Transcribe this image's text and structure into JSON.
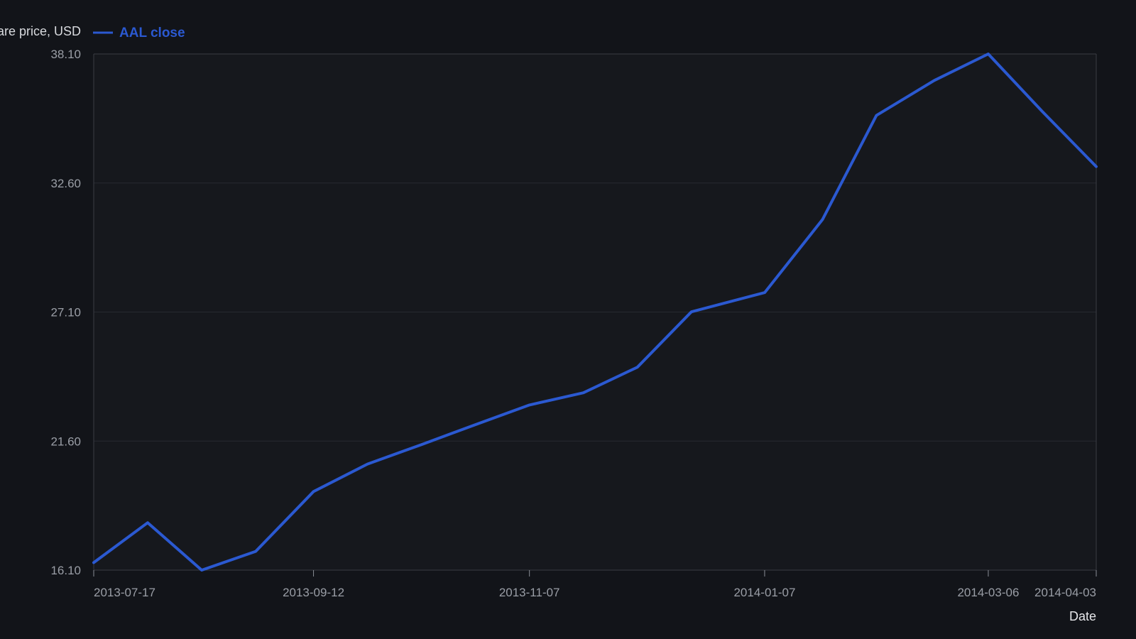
{
  "colors": {
    "background": "#121419",
    "plot_background": "#16181d",
    "grid": "#262930",
    "axis": "#3a3d44",
    "series": "#2b59d1"
  },
  "chart_data": {
    "type": "line",
    "xlabel": "Date",
    "ylabel": "Share price, USD",
    "ylim": [
      16.1,
      38.1
    ],
    "yticks": [
      "16.10",
      "21.60",
      "27.10",
      "32.60",
      "38.10"
    ],
    "xticks": [
      "2013-07-17",
      "2013-09-12",
      "2013-11-07",
      "2014-01-07",
      "2014-03-06",
      "2014-04-03"
    ],
    "grid": true,
    "legend_position": "top-left",
    "series": [
      {
        "name": "AAL close",
        "x": [
          "2013-07-17",
          "2013-07-31",
          "2013-08-14",
          "2013-08-28",
          "2013-09-12",
          "2013-09-26",
          "2013-10-10",
          "2013-10-24",
          "2013-11-07",
          "2013-11-21",
          "2013-12-05",
          "2013-12-19",
          "2014-01-07",
          "2014-01-22",
          "2014-02-05",
          "2014-02-20",
          "2014-03-06",
          "2014-03-20",
          "2014-04-03"
        ],
        "values": [
          16.42,
          18.12,
          16.1,
          16.9,
          19.45,
          20.62,
          21.45,
          22.3,
          23.14,
          23.66,
          24.75,
          27.11,
          27.93,
          31.04,
          35.48,
          36.97,
          38.1,
          35.65,
          33.3
        ]
      }
    ]
  }
}
